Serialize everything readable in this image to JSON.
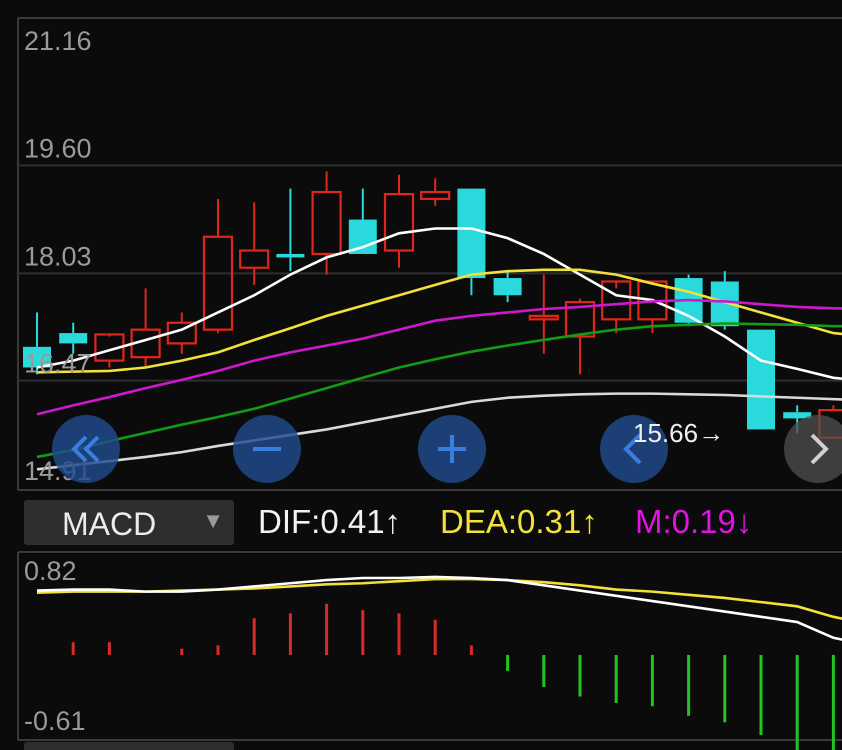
{
  "chart_data": [
    {
      "type": "candlestick",
      "title": "",
      "y_ticks": [
        "21.16",
        "19.60",
        "18.03",
        "16.47",
        "14.91"
      ],
      "ylim": [
        14.91,
        21.16
      ],
      "grid": true,
      "candles": [
        {
          "o": 16.7,
          "h": 17.2,
          "l": 16.3,
          "c": 16.4
        },
        {
          "o": 16.9,
          "h": 17.05,
          "l": 16.6,
          "c": 16.75
        },
        {
          "o": 16.5,
          "h": 16.85,
          "l": 16.4,
          "c": 16.88
        },
        {
          "o": 16.55,
          "h": 17.55,
          "l": 16.4,
          "c": 16.95
        },
        {
          "o": 16.75,
          "h": 17.2,
          "l": 16.6,
          "c": 17.05
        },
        {
          "o": 16.95,
          "h": 18.85,
          "l": 16.9,
          "c": 18.3
        },
        {
          "o": 17.85,
          "h": 18.8,
          "l": 17.6,
          "c": 18.1
        },
        {
          "o": 18.05,
          "h": 19.0,
          "l": 17.8,
          "c": 18.0
        },
        {
          "o": 18.05,
          "h": 19.25,
          "l": 17.75,
          "c": 18.95
        },
        {
          "o": 18.55,
          "h": 19.0,
          "l": 18.05,
          "c": 18.05
        },
        {
          "o": 18.1,
          "h": 19.2,
          "l": 17.85,
          "c": 18.92
        },
        {
          "o": 18.85,
          "h": 19.15,
          "l": 18.75,
          "c": 18.95
        },
        {
          "o": 19.0,
          "h": 19.0,
          "l": 17.45,
          "c": 17.7
        },
        {
          "o": 17.7,
          "h": 17.8,
          "l": 17.35,
          "c": 17.45
        },
        {
          "o": 17.1,
          "h": 17.75,
          "l": 16.6,
          "c": 17.15
        },
        {
          "o": 16.85,
          "h": 17.4,
          "l": 16.3,
          "c": 17.35
        },
        {
          "o": 17.1,
          "h": 17.55,
          "l": 16.9,
          "c": 17.65
        },
        {
          "o": 17.1,
          "h": 17.65,
          "l": 16.9,
          "c": 17.65
        },
        {
          "o": 17.7,
          "h": 17.75,
          "l": 17.0,
          "c": 17.05
        },
        {
          "o": 17.65,
          "h": 17.8,
          "l": 16.95,
          "c": 17.0
        },
        {
          "o": 16.95,
          "h": 16.95,
          "l": 15.5,
          "c": 15.5
        },
        {
          "o": 15.75,
          "h": 15.85,
          "l": 15.45,
          "c": 15.66
        },
        {
          "o": 15.38,
          "h": 15.85,
          "l": 15.38,
          "c": 15.78
        },
        {
          "o": 15.75,
          "h": 16.2,
          "l": 15.6,
          "c": 16.25
        },
        {
          "o": 16.05,
          "h": 16.5,
          "l": 16.0,
          "c": 16.2
        },
        {
          "o": 16.55,
          "h": 17.1,
          "l": 16.5,
          "c": 17.05
        }
      ],
      "ma_lines": [
        {
          "color": "#ffffff",
          "values": [
            16.4,
            16.5,
            16.65,
            16.8,
            16.95,
            17.2,
            17.45,
            17.75,
            18.0,
            18.15,
            18.35,
            18.42,
            18.42,
            18.28,
            18.05,
            17.75,
            17.45,
            17.38,
            17.15,
            16.85,
            16.5,
            16.38,
            16.25,
            16.2,
            16.2,
            16.4
          ]
        },
        {
          "color": "#f2e13a",
          "values": [
            16.33,
            16.34,
            16.35,
            16.4,
            16.5,
            16.62,
            16.8,
            16.97,
            17.15,
            17.3,
            17.45,
            17.6,
            17.75,
            17.8,
            17.82,
            17.82,
            17.75,
            17.62,
            17.5,
            17.35,
            17.2,
            17.05,
            16.9,
            16.85,
            16.85,
            16.85
          ]
        },
        {
          "color": "#cc19cc",
          "values": [
            15.72,
            15.85,
            15.97,
            16.1,
            16.22,
            16.35,
            16.5,
            16.62,
            16.72,
            16.82,
            16.95,
            17.08,
            17.15,
            17.2,
            17.25,
            17.28,
            17.32,
            17.36,
            17.38,
            17.36,
            17.32,
            17.28,
            17.26,
            17.25,
            17.26,
            17.28
          ]
        },
        {
          "color": "#139c13",
          "values": [
            15.1,
            15.2,
            15.33,
            15.45,
            15.57,
            15.68,
            15.8,
            15.95,
            16.1,
            16.25,
            16.4,
            16.52,
            16.63,
            16.72,
            16.8,
            16.88,
            16.95,
            17.0,
            17.02,
            17.04,
            17.03,
            17.02,
            17.0,
            17.0,
            17.02,
            17.05
          ]
        },
        {
          "color": "#d9d9d9",
          "values": [
            14.92,
            14.98,
            15.04,
            15.1,
            15.17,
            15.26,
            15.34,
            15.42,
            15.5,
            15.6,
            15.7,
            15.8,
            15.9,
            15.96,
            15.99,
            16.01,
            16.02,
            16.02,
            16.01,
            16.0,
            15.98,
            15.96,
            15.94,
            15.92,
            15.9,
            15.88
          ]
        }
      ],
      "min_marker": {
        "label": "15.66→",
        "index": 21
      }
    },
    {
      "type": "macd",
      "y_ticks": [
        "0.82",
        "-0.61"
      ],
      "ylim": [
        -0.61,
        0.82
      ],
      "histogram": [
        0,
        0.08,
        0.08,
        0,
        0.04,
        0.06,
        0.23,
        0.26,
        0.32,
        0.28,
        0.26,
        0.22,
        0.06,
        -0.1,
        -0.2,
        -0.26,
        -0.3,
        -0.32,
        -0.38,
        -0.42,
        -0.5,
        -0.6,
        -0.63,
        -0.58,
        -0.5,
        -0.4
      ],
      "dif": [
        0.7,
        0.71,
        0.71,
        0.69,
        0.69,
        0.71,
        0.74,
        0.77,
        0.8,
        0.82,
        0.82,
        0.83,
        0.82,
        0.8,
        0.75,
        0.7,
        0.65,
        0.6,
        0.55,
        0.5,
        0.45,
        0.4,
        0.25,
        0.18,
        0.1,
        0.03
      ],
      "dea": [
        0.68,
        0.69,
        0.69,
        0.69,
        0.7,
        0.71,
        0.72,
        0.74,
        0.76,
        0.77,
        0.79,
        0.81,
        0.81,
        0.8,
        0.78,
        0.75,
        0.71,
        0.69,
        0.66,
        0.63,
        0.59,
        0.55,
        0.45,
        0.38,
        0.3,
        0.25
      ]
    }
  ],
  "ui": {
    "macd_label": "MACD",
    "dropdown_arrow": "▼",
    "dif_text": "DIF:0.41↑",
    "dea_text": "DEA:0.31↑",
    "m_text": "M:0.19↓",
    "min_label": "15.66→",
    "colors": {
      "up": "#e0261b",
      "down": "#2ad9dc",
      "dif": "#ffffff",
      "dea": "#f2e13a",
      "m": "#e014e0",
      "hist_up": "#d92a2a",
      "hist_down": "#21c421"
    },
    "nav_buttons": [
      {
        "name": "first-page-button",
        "icon": "double-chevron-left-icon"
      },
      {
        "name": "zoom-out-button",
        "icon": "minus-icon"
      },
      {
        "name": "zoom-in-button",
        "icon": "plus-icon"
      },
      {
        "name": "prev-button",
        "icon": "chevron-left-icon"
      },
      {
        "name": "next-button",
        "icon": "chevron-right-icon"
      }
    ]
  }
}
